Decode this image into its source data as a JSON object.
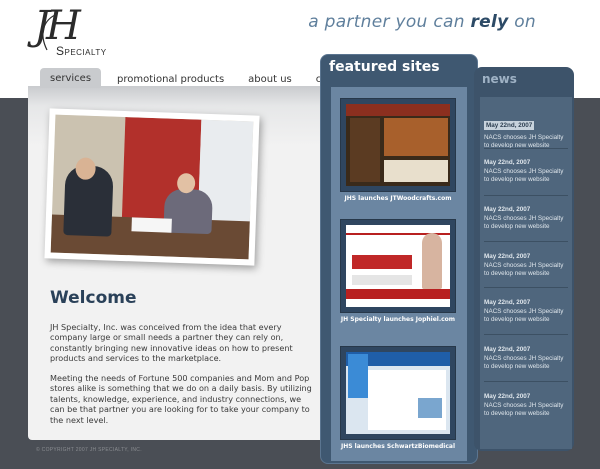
{
  "brand": {
    "logo_mark": "JH",
    "logo_word": "Specialty",
    "tagline_pre": "a partner you can ",
    "tagline_bold": "rely",
    "tagline_post": " on"
  },
  "nav": {
    "items": [
      {
        "label": "services"
      },
      {
        "label": "promotional products"
      },
      {
        "label": "about us"
      },
      {
        "label": "contact us"
      }
    ]
  },
  "main": {
    "welcome_title": "Welcome",
    "paragraph_1": "JH Specialty, Inc. was conceived from the idea that every company large or small needs a partner they can rely on, constantly bringing new innovative ideas on how to present products and services to the marketplace.",
    "paragraph_2": "Meeting the needs of Fortune 500 companies and Mom and Pop stores alike is something that we do on a daily basis. By utilizing talents, knowledge, experience, and industry connections, we can be that partner you are looking for to take your company to the next level."
  },
  "featured": {
    "title": "featured sites",
    "sites": [
      {
        "caption": "JHS launches JTWoodcrafts.com"
      },
      {
        "caption": "JH Specialty launches Jophiel.com"
      },
      {
        "caption": "JHS launches SchwartzBiomedical"
      }
    ]
  },
  "news": {
    "title": "news",
    "items": [
      {
        "date": "May 22nd, 2007",
        "text": "NACS chooses JH Specialty to develop new website"
      },
      {
        "date": "May 22nd, 2007",
        "text": "NACS chooses JH Specialty to develop new website"
      },
      {
        "date": "May 22nd, 2007",
        "text": "NACS chooses JH Specialty to develop new website"
      },
      {
        "date": "May 22nd, 2007",
        "text": "NACS chooses JH Specialty to develop new website"
      },
      {
        "date": "May 22nd, 2007",
        "text": "NACS chooses JH Specialty to develop new website"
      },
      {
        "date": "May 22nd, 2007",
        "text": "NACS chooses JH Specialty to develop new website"
      },
      {
        "date": "May 22nd, 2007",
        "text": "NACS chooses JH Specialty to develop new website"
      }
    ]
  },
  "footer": {
    "copyright": "© COPYRIGHT 2007 JH SPECIALTY, INC."
  }
}
